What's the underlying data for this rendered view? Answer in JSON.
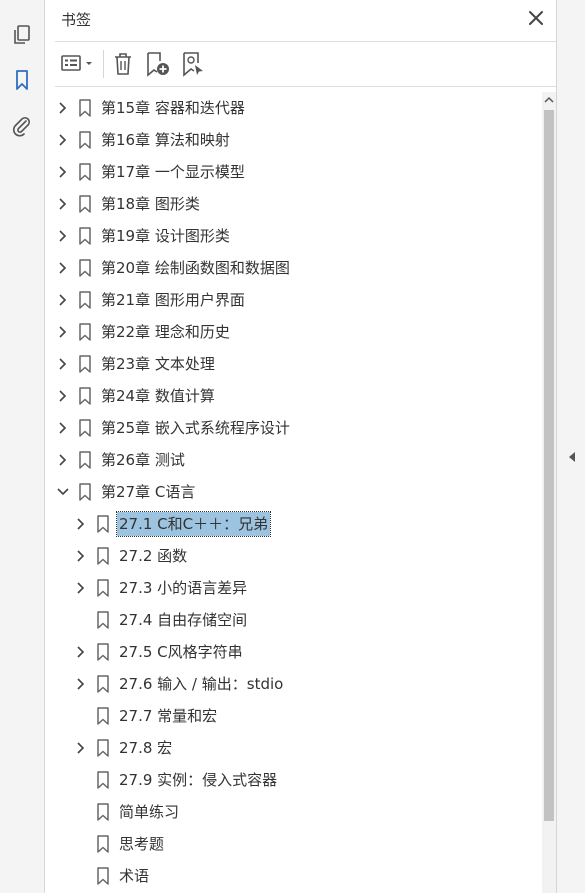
{
  "panel": {
    "title": "书签"
  },
  "items": [
    {
      "label": "第15章  容器和迭代器",
      "expand": "collapsed"
    },
    {
      "label": "第16章  算法和映射",
      "expand": "collapsed"
    },
    {
      "label": "第17章  一个显示模型",
      "expand": "collapsed"
    },
    {
      "label": "第18章  图形类",
      "expand": "collapsed"
    },
    {
      "label": "第19章  设计图形类",
      "expand": "collapsed"
    },
    {
      "label": "第20章  绘制函数图和数据图",
      "expand": "collapsed"
    },
    {
      "label": "第21章  图形用户界面",
      "expand": "collapsed"
    },
    {
      "label": "第22章  理念和历史",
      "expand": "collapsed"
    },
    {
      "label": "第23章  文本处理",
      "expand": "collapsed"
    },
    {
      "label": "第24章  数值计算",
      "expand": "collapsed"
    },
    {
      "label": "第25章  嵌入式系统程序设计",
      "expand": "collapsed"
    },
    {
      "label": "第26章  测试",
      "expand": "collapsed"
    },
    {
      "label": "第27章  C语言",
      "expand": "expanded"
    },
    {
      "label": "27.1 C和C＋＋：兄弟",
      "expand": "collapsed",
      "child": true,
      "selected": true
    },
    {
      "label": "27.2 函数",
      "expand": "collapsed",
      "child": true
    },
    {
      "label": "27.3 小的语言差异",
      "expand": "collapsed",
      "child": true
    },
    {
      "label": "27.4 自由存储空间",
      "expand": "none",
      "child": true
    },
    {
      "label": "27.5 C风格字符串",
      "expand": "collapsed",
      "child": true
    },
    {
      "label": "27.6 输入 / 输出：stdio",
      "expand": "collapsed",
      "child": true
    },
    {
      "label": "27.7 常量和宏",
      "expand": "none",
      "child": true
    },
    {
      "label": "27.8 宏",
      "expand": "collapsed",
      "child": true
    },
    {
      "label": "27.9 实例：侵入式容器",
      "expand": "none",
      "child": true
    },
    {
      "label": "简单练习",
      "expand": "none",
      "child": true
    },
    {
      "label": "思考题",
      "expand": "none",
      "child": true
    },
    {
      "label": "术语",
      "expand": "none",
      "child": true
    }
  ]
}
